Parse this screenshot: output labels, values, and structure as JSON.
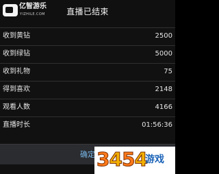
{
  "logo": {
    "text": "亿智游乐",
    "sub": "YIZHILE.COM"
  },
  "dialog": {
    "title": "直播已结束",
    "stats": [
      {
        "label": "收到黄钻",
        "value": "2500"
      },
      {
        "label": "收到绿钻",
        "value": "5000"
      },
      {
        "label": "收到礼物",
        "value": "75"
      },
      {
        "label": "得到喜欢",
        "value": "2148"
      },
      {
        "label": "观看人数",
        "value": "4166"
      },
      {
        "label": "直播时长",
        "value": "01:56:36"
      }
    ],
    "confirm_label": "确定"
  },
  "watermark": {
    "digits": [
      "3",
      "4",
      "5",
      "4"
    ],
    "text": "游戏"
  }
}
